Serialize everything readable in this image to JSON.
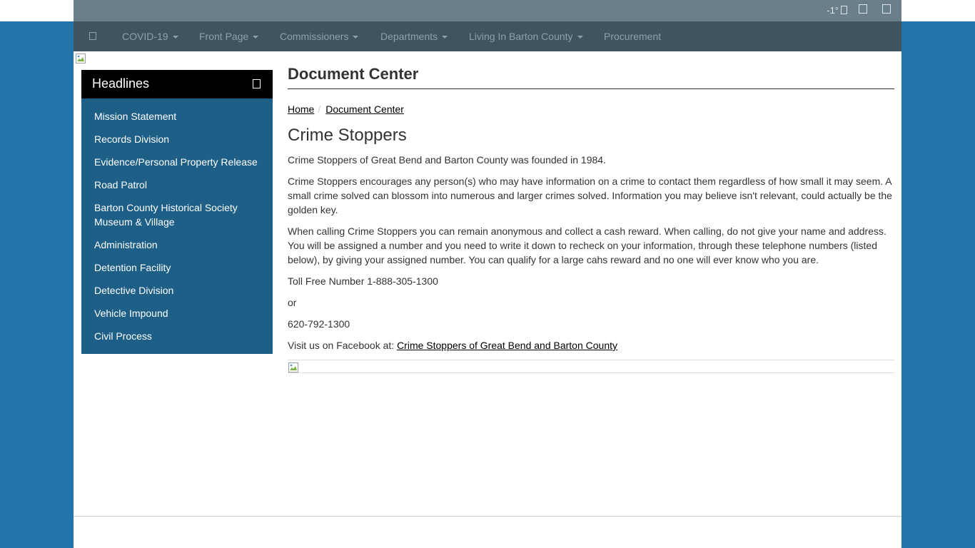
{
  "utility": {
    "weather": "-1°",
    "icons": [
      "weather-icon",
      "search-icon",
      "menu-icon"
    ]
  },
  "nav": {
    "home_icon": "home-icon",
    "items": [
      {
        "label": "COVID-19",
        "dropdown": true
      },
      {
        "label": "Front Page",
        "dropdown": true
      },
      {
        "label": "Commissioners",
        "dropdown": true
      },
      {
        "label": "Departments",
        "dropdown": true
      },
      {
        "label": "Living In Barton County",
        "dropdown": true
      },
      {
        "label": "Procurement",
        "dropdown": false
      }
    ]
  },
  "sidebar": {
    "title": "Headlines",
    "toggle_icon": "toggle-icon",
    "items": [
      {
        "label": "Mission Statement"
      },
      {
        "label": "Records Division"
      },
      {
        "label": "Evidence/Personal Property Release"
      },
      {
        "label": "Road Patrol"
      },
      {
        "label": "Barton County Historical Society Museum & Village"
      },
      {
        "label": "Administration"
      },
      {
        "label": "Detention Facility"
      },
      {
        "label": "Detective Division"
      },
      {
        "label": "Vehicle Impound"
      },
      {
        "label": "Civil Process"
      }
    ]
  },
  "main": {
    "page_title": "Document Center",
    "breadcrumb": [
      {
        "label": "Home"
      },
      {
        "label": "Document Center"
      }
    ],
    "breadcrumb_separator": "/",
    "section_title": "Crime Stoppers",
    "paragraphs": [
      "Crime Stoppers of Great Bend and Barton County was founded in 1984.",
      "Crime Stoppers encourages any person(s) who may have information on a crime to contact them regardless of how small it may seem.  A small crime solved can blossom into numerous and larger crimes solved.  Information you may believe isn't relevant, could actually be the golden key.",
      "When calling Crime Stoppers you can remain anonymous and collect a cash reward.  When calling, do not give your name and address.  You will be assigned a number and you need to write it down to recheck on your information, through these telephone numbers (listed below), by giving your assigned number.  You can qualify for a large cahs reward and no one will ever know who you are.",
      "Toll Free Number 1-888-305-1300",
      "or",
      "620-792-1300"
    ],
    "facebook_prefix": "Visit us on Facebook at: ",
    "facebook_link": "Crime Stoppers of Great Bend and Barton County"
  },
  "colors": {
    "background": "#2374ab",
    "utility_bar": "#6a7f89",
    "navbar": "#3f545f",
    "sidebar": "#1d5f87",
    "sidebar_header": "#000000"
  }
}
